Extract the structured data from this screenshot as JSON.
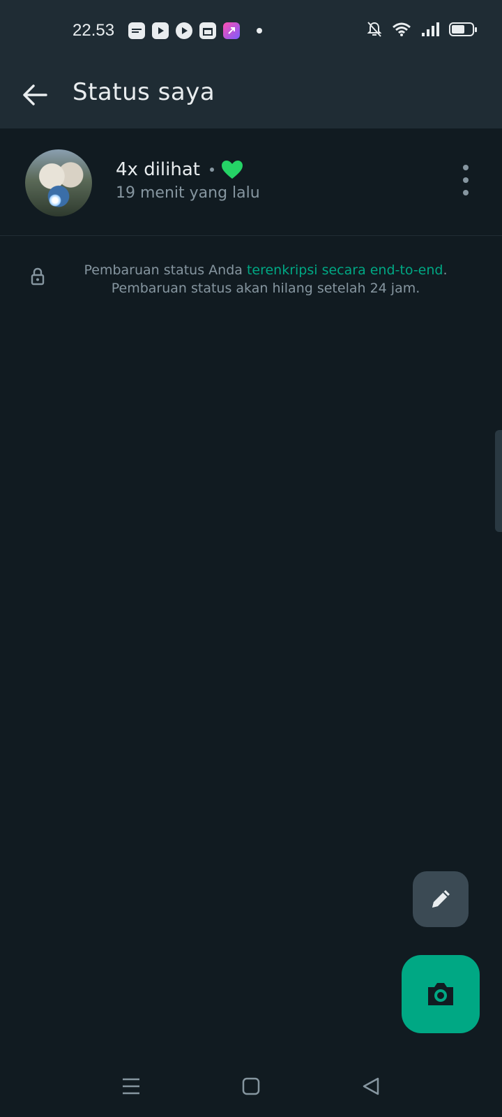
{
  "status_bar": {
    "time": "22.53",
    "app_icons": [
      "news-app-icon",
      "youtube-icon",
      "play-icon",
      "gift-icon",
      "shortcut-app-icon"
    ],
    "right_icons": [
      "bell-off-icon",
      "wifi-icon",
      "signal-icon",
      "battery-icon"
    ]
  },
  "header": {
    "title": "Status saya",
    "back_icon": "arrow-left-icon"
  },
  "status_item": {
    "views": "4x dilihat",
    "time_ago": "19 menit yang lalu",
    "reaction_icon": "green-heart-icon",
    "menu_icon": "more-vertical-icon"
  },
  "encryption_note": {
    "prefix": "Pembaruan status Anda ",
    "link": "terenkripsi secara end-to-end",
    "suffix": ". Pembaruan status akan hilang setelah 24 jam."
  },
  "fabs": {
    "pencil_icon": "pencil-icon",
    "camera_icon": "camera-icon"
  },
  "navbar": {
    "icons": [
      "menu-icon",
      "home-square-icon",
      "back-triangle-icon"
    ]
  },
  "colors": {
    "background": "#111b21",
    "header": "#1f2c34",
    "accent": "#00a884",
    "heart": "#25d366",
    "secondary_text": "#8696a0"
  }
}
